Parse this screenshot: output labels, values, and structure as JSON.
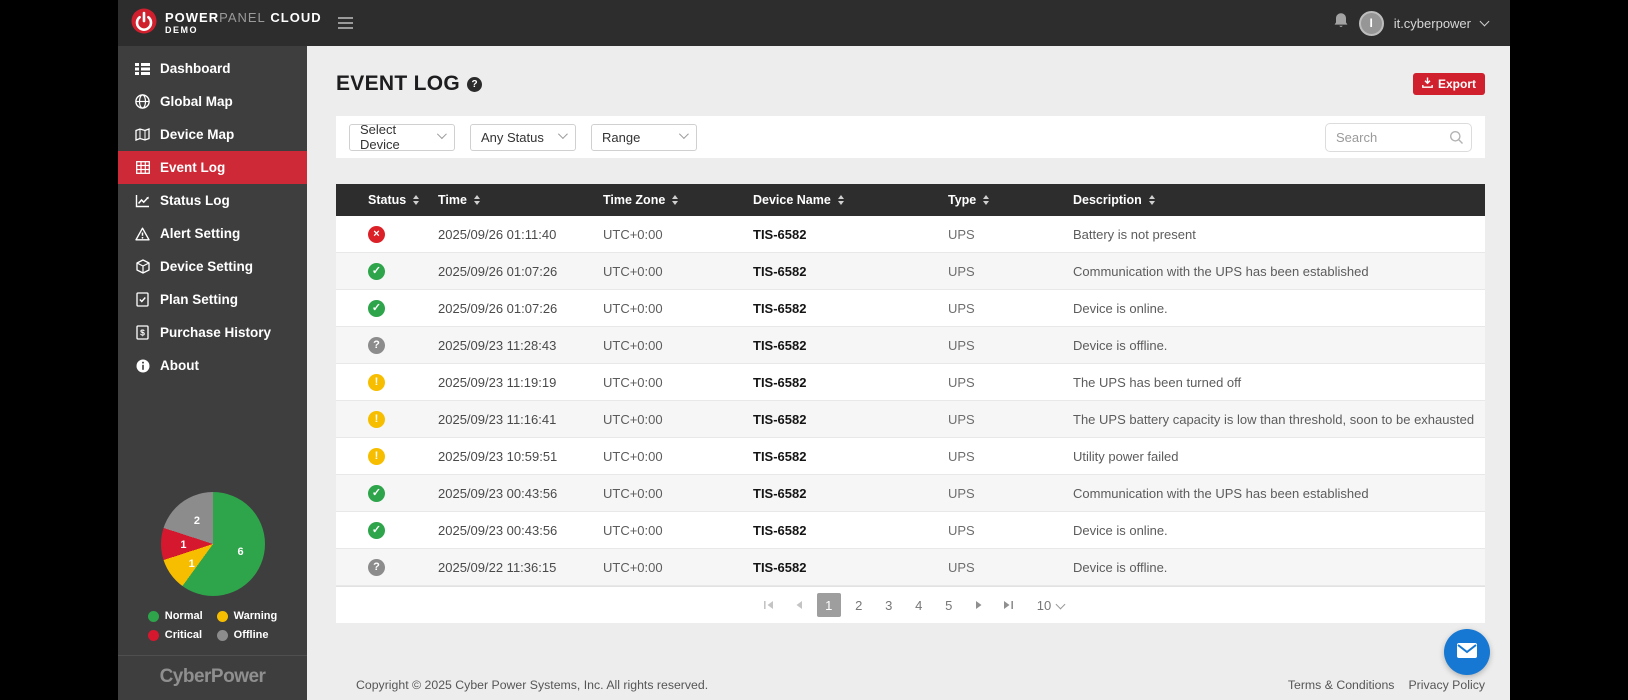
{
  "colors": {
    "accent_red": "#cd2936",
    "export_red": "#d0202e",
    "status_ok_green": "#2ea44b",
    "status_warning_yellow": "#f7be00",
    "status_error_red": "#dc2028",
    "status_offline_gray": "#8c8c8c",
    "fab_blue": "#1678d2",
    "topbar_dark": "#2d2d2d",
    "sidebar_dark": "#3e3e3e"
  },
  "header": {
    "logo": {
      "power": "POWER",
      "panel": "PANEL",
      "cloud": "CLOUD",
      "demo": "DEMO"
    },
    "avatar_letter": "I",
    "username": "it.cyberpower"
  },
  "sidebar": {
    "items": [
      {
        "label": "Dashboard"
      },
      {
        "label": "Global Map"
      },
      {
        "label": "Device Map"
      },
      {
        "label": "Event Log"
      },
      {
        "label": "Status Log"
      },
      {
        "label": "Alert Setting"
      },
      {
        "label": "Device Setting"
      },
      {
        "label": "Plan Setting"
      },
      {
        "label": "Purchase History"
      },
      {
        "label": "About"
      }
    ],
    "active_item": "Event Log",
    "brand": "CyberPower"
  },
  "chart_data": {
    "type": "pie",
    "title": "Device status summary",
    "labels": [
      "Normal",
      "Warning",
      "Critical",
      "Offline"
    ],
    "values": [
      6,
      1,
      1,
      2
    ],
    "colors": [
      "#2ea44b",
      "#f7be00",
      "#d6182e",
      "#8c8c8c"
    ],
    "legend_position": "bottom"
  },
  "main": {
    "title": "EVENT LOG",
    "help_glyph": "?",
    "export_label": "Export",
    "filters": {
      "device": "Select Device",
      "status": "Any Status",
      "range": "Range",
      "search_placeholder": "Search"
    },
    "table": {
      "columns": [
        "Status",
        "Time",
        "Time Zone",
        "Device Name",
        "Type",
        "Description"
      ],
      "rows": [
        {
          "status": "error",
          "glyph": "×",
          "time": "2025/09/26 01:11:40",
          "timezone": "UTC+0:00",
          "device": "TIS-6582",
          "type": "UPS",
          "description": "Battery is not present"
        },
        {
          "status": "ok",
          "glyph": "✓",
          "time": "2025/09/26 01:07:26",
          "timezone": "UTC+0:00",
          "device": "TIS-6582",
          "type": "UPS",
          "description": "Communication with the UPS has been established"
        },
        {
          "status": "ok",
          "glyph": "✓",
          "time": "2025/09/26 01:07:26",
          "timezone": "UTC+0:00",
          "device": "TIS-6582",
          "type": "UPS",
          "description": "Device is online."
        },
        {
          "status": "offline",
          "glyph": "?",
          "time": "2025/09/23 11:28:43",
          "timezone": "UTC+0:00",
          "device": "TIS-6582",
          "type": "UPS",
          "description": "Device is offline."
        },
        {
          "status": "warning",
          "glyph": "!",
          "time": "2025/09/23 11:19:19",
          "timezone": "UTC+0:00",
          "device": "TIS-6582",
          "type": "UPS",
          "description": "The UPS has been turned off"
        },
        {
          "status": "warning",
          "glyph": "!",
          "time": "2025/09/23 11:16:41",
          "timezone": "UTC+0:00",
          "device": "TIS-6582",
          "type": "UPS",
          "description": "The UPS battery capacity is low than threshold, soon to be exhausted"
        },
        {
          "status": "warning",
          "glyph": "!",
          "time": "2025/09/23 10:59:51",
          "timezone": "UTC+0:00",
          "device": "TIS-6582",
          "type": "UPS",
          "description": "Utility power failed"
        },
        {
          "status": "ok",
          "glyph": "✓",
          "time": "2025/09/23 00:43:56",
          "timezone": "UTC+0:00",
          "device": "TIS-6582",
          "type": "UPS",
          "description": "Communication with the UPS has been established"
        },
        {
          "status": "ok",
          "glyph": "✓",
          "time": "2025/09/23 00:43:56",
          "timezone": "UTC+0:00",
          "device": "TIS-6582",
          "type": "UPS",
          "description": "Device is online."
        },
        {
          "status": "offline",
          "glyph": "?",
          "time": "2025/09/22 11:36:15",
          "timezone": "UTC+0:00",
          "device": "TIS-6582",
          "type": "UPS",
          "description": "Device is offline."
        }
      ]
    },
    "pagination": {
      "pages": [
        "1",
        "2",
        "3",
        "4",
        "5"
      ],
      "active_page": "1",
      "page_size": "10"
    }
  },
  "footer": {
    "copyright": "Copyright © 2025 Cyber Power Systems, Inc. All rights reserved.",
    "terms": "Terms & Conditions",
    "privacy": "Privacy Policy"
  }
}
